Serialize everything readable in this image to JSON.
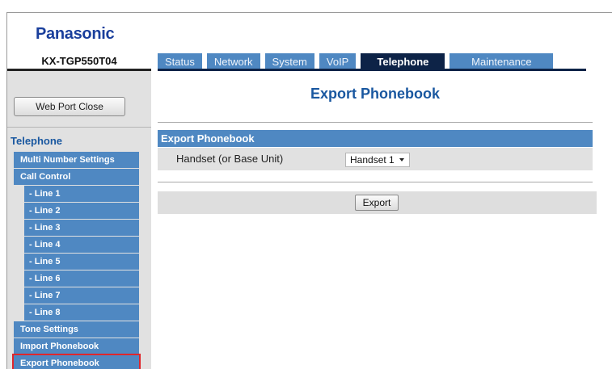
{
  "brand": {
    "logo_text": "Panasonic",
    "accent": "#1a3f9c"
  },
  "header": {
    "model": "KX-TGP550T04",
    "tabs": [
      {
        "label": "Status",
        "active": false
      },
      {
        "label": "Network",
        "active": false
      },
      {
        "label": "System",
        "active": false
      },
      {
        "label": "VoIP",
        "active": false
      },
      {
        "label": "Telephone",
        "active": true
      },
      {
        "label": "Maintenance",
        "active": false
      }
    ]
  },
  "sidebar": {
    "web_port_close": "Web Port Close",
    "section_title": "Telephone",
    "items": [
      {
        "label": "Multi Number Settings"
      },
      {
        "label": "Call Control"
      },
      {
        "label": "- Line 1"
      },
      {
        "label": "- Line 2"
      },
      {
        "label": "- Line 3"
      },
      {
        "label": "- Line 4"
      },
      {
        "label": "- Line 5"
      },
      {
        "label": "- Line 6"
      },
      {
        "label": "- Line 7"
      },
      {
        "label": "- Line 8"
      },
      {
        "label": "Tone Settings"
      },
      {
        "label": "Import Phonebook"
      },
      {
        "label": "Export Phonebook",
        "selected": true
      }
    ]
  },
  "main": {
    "title": "Export Phonebook",
    "section_header": "Export Phonebook",
    "field_label": "Handset (or Base Unit)",
    "select_value": "Handset 1",
    "export_button": "Export"
  },
  "colors": {
    "nav_blue": "#4f88c2",
    "active_tab": "#0d2347",
    "title_blue": "#1a58a0",
    "selected_outline": "#e0262b"
  }
}
